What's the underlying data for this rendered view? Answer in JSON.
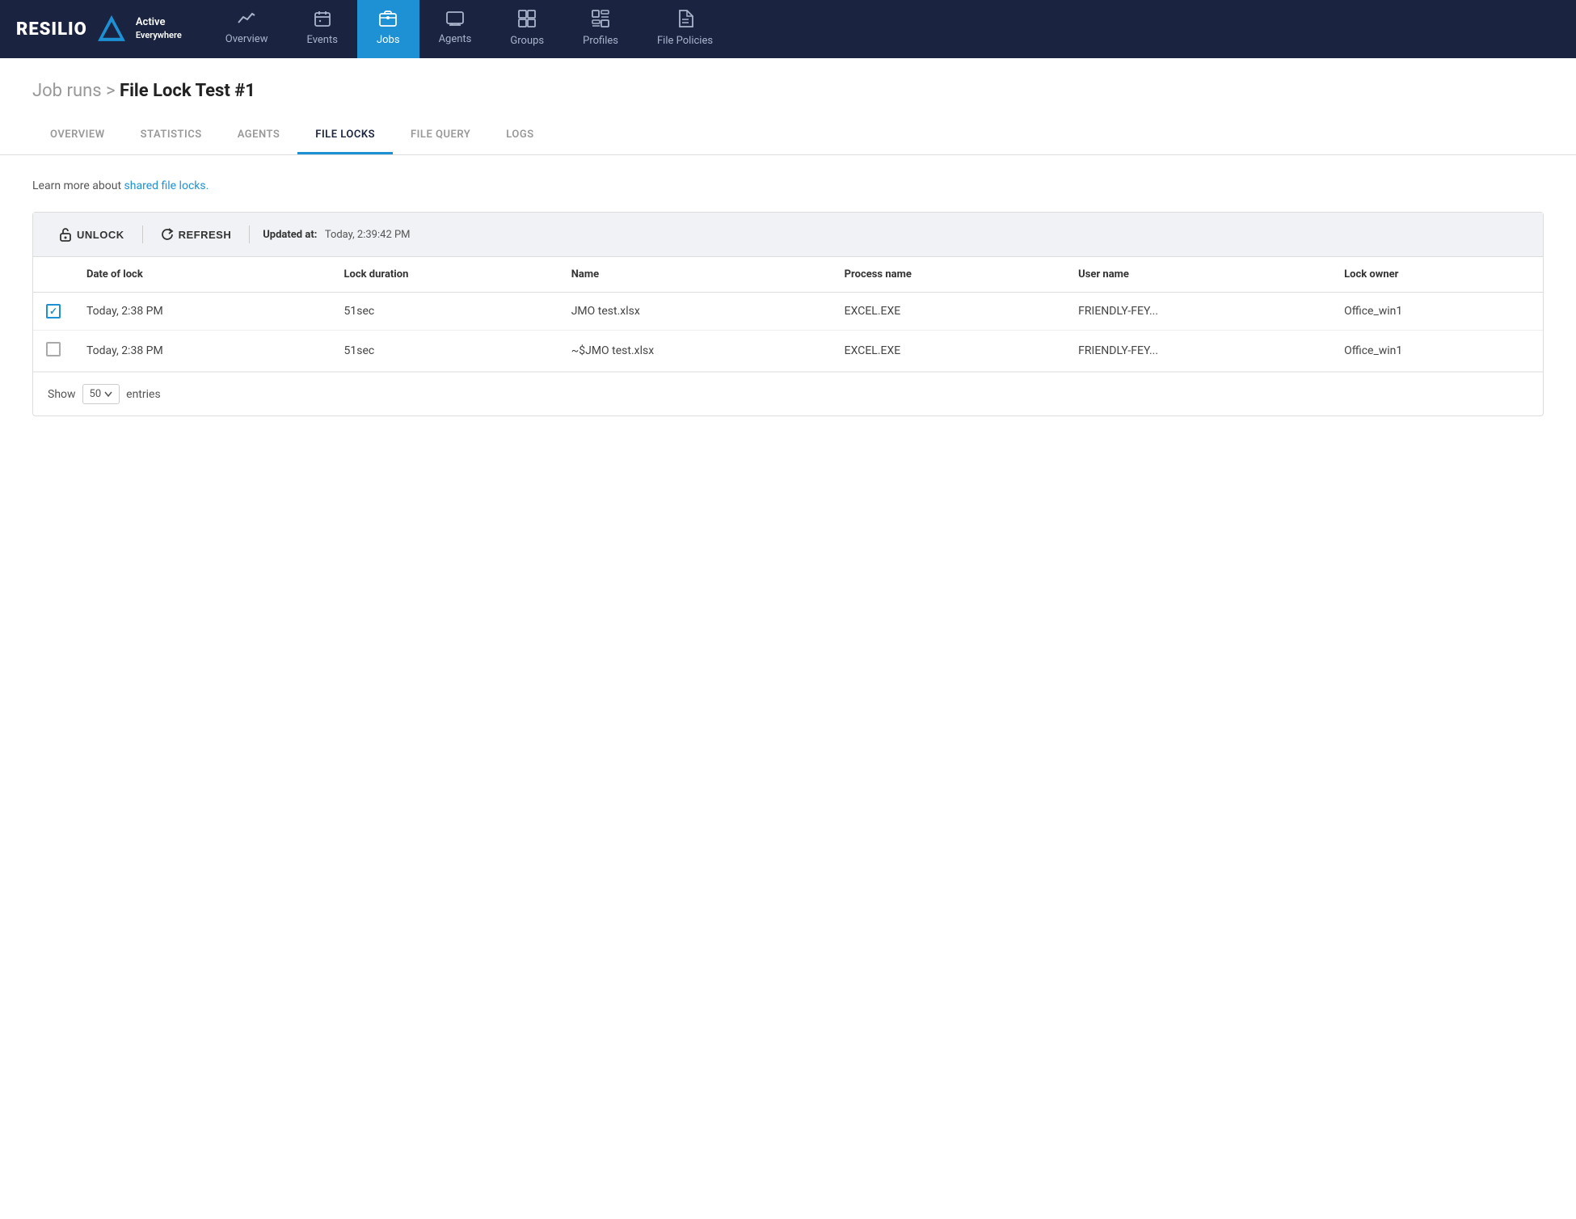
{
  "brand": {
    "logo_text": "RESILIO",
    "tag_line1": "Active",
    "tag_line2": "Everywhere"
  },
  "nav": {
    "items": [
      {
        "id": "overview",
        "label": "Overview",
        "icon": "📈",
        "active": false
      },
      {
        "id": "events",
        "label": "Events",
        "icon": "🗓",
        "active": false
      },
      {
        "id": "jobs",
        "label": "Jobs",
        "icon": "🗂",
        "active": true
      },
      {
        "id": "agents",
        "label": "Agents",
        "icon": "🖥",
        "active": false
      },
      {
        "id": "groups",
        "label": "Groups",
        "icon": "⬛",
        "active": false
      },
      {
        "id": "profiles",
        "label": "Profiles",
        "icon": "▣",
        "active": false
      },
      {
        "id": "file-policies",
        "label": "File Policies",
        "icon": "📋",
        "active": false
      }
    ]
  },
  "breadcrumb": {
    "parent": "Job runs",
    "separator": " > ",
    "current": "File Lock Test #1"
  },
  "sub_tabs": {
    "items": [
      {
        "id": "overview",
        "label": "OVERVIEW",
        "active": false
      },
      {
        "id": "statistics",
        "label": "STATISTICS",
        "active": false
      },
      {
        "id": "agents",
        "label": "AGENTS",
        "active": false
      },
      {
        "id": "file-locks",
        "label": "FILE LOCKS",
        "active": true
      },
      {
        "id": "file-query",
        "label": "FILE QUERY",
        "active": false
      },
      {
        "id": "logs",
        "label": "LOGS",
        "active": false
      }
    ]
  },
  "info_text": "Learn more about ",
  "info_link": "shared file locks.",
  "toolbar": {
    "unlock_label": "UNLOCK",
    "refresh_label": "REFRESH",
    "updated_label": "Updated at:",
    "updated_value": "Today, 2:39:42 PM"
  },
  "table": {
    "columns": [
      "Date of lock",
      "Lock duration",
      "Name",
      "Process name",
      "User name",
      "Lock owner"
    ],
    "rows": [
      {
        "checked": true,
        "date_of_lock": "Today, 2:38 PM",
        "lock_duration": "51sec",
        "name": "JMO test.xlsx",
        "process_name": "EXCEL.EXE",
        "user_name": "FRIENDLY-FEY...",
        "lock_owner": "Office_win1"
      },
      {
        "checked": false,
        "date_of_lock": "Today, 2:38 PM",
        "lock_duration": "51sec",
        "name": "~$JMO test.xlsx",
        "process_name": "EXCEL.EXE",
        "user_name": "FRIENDLY-FEY...",
        "lock_owner": "Office_win1"
      }
    ]
  },
  "pagination": {
    "show_label": "Show",
    "entries_label": "entries",
    "per_page": "50"
  }
}
